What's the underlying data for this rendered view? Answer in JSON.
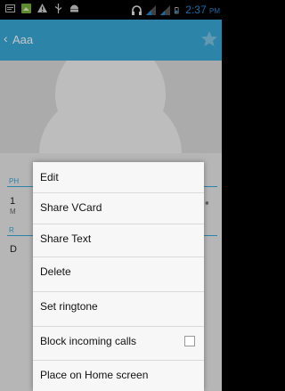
{
  "status_bar": {
    "time": "2:37",
    "ampm": "PM",
    "icons": [
      "image-icon",
      "gallery-icon",
      "alert-icon",
      "usb-icon",
      "android-icon",
      "headset-icon",
      "signal-icon",
      "signal-icon-2",
      "battery-icon"
    ]
  },
  "action_bar": {
    "title": "Aaa",
    "accent": "#39a9d9"
  },
  "content": {
    "section_phone_label": "PH",
    "phone_number": "1",
    "phone_type": "M",
    "section_ringtone_label": "R",
    "ringtone_value": "D"
  },
  "menu": {
    "items": [
      {
        "label": "Edit"
      },
      {
        "label": "Share VCard"
      },
      {
        "label": "Share Text"
      },
      {
        "label": "Delete"
      },
      {
        "label": "Set ringtone"
      },
      {
        "label": "Block incoming calls",
        "checked": false
      },
      {
        "label": "Place on Home screen"
      }
    ]
  }
}
